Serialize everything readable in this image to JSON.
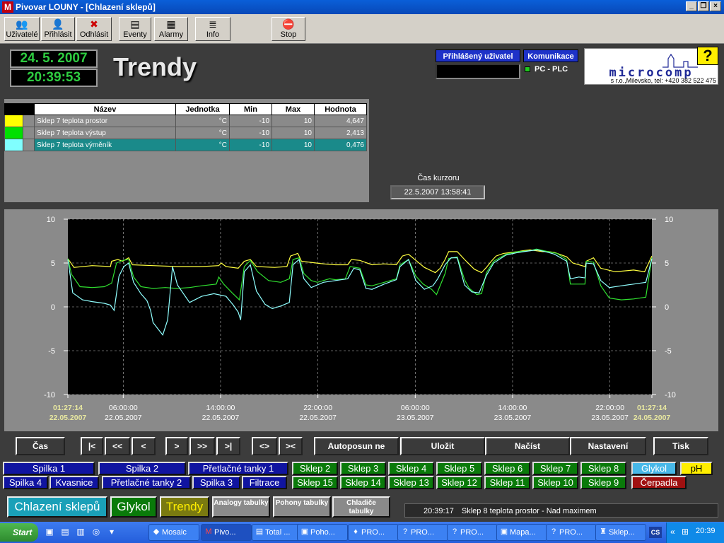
{
  "window": {
    "title": "Pivovar LOUNY - [Chlazení sklepů]"
  },
  "toolbar": [
    {
      "label": "Uživatelé",
      "icon": "users-icon",
      "glyph": "👥"
    },
    {
      "label": "Přihlásit",
      "icon": "login-icon",
      "glyph": "👤"
    },
    {
      "label": "Odhlásit",
      "icon": "logout-icon",
      "glyph": "✖"
    },
    {
      "label": "Eventy",
      "icon": "events-icon",
      "glyph": "▤"
    },
    {
      "label": "Alarmy",
      "icon": "alarms-icon",
      "glyph": "▦"
    },
    {
      "label": "Info",
      "icon": "info-icon",
      "glyph": "≣"
    },
    {
      "label": "Stop",
      "icon": "stop-icon",
      "glyph": "⛔"
    }
  ],
  "header": {
    "date": "24. 5. 2007",
    "time": "20:39:53",
    "title": "Trendy",
    "logged_user_label": "Přihlášený uživatel",
    "comm_label": "Komunikace",
    "comm_status": "PC - PLC",
    "logo_text": "microcomp",
    "logo_sub": "s r.o.,Milevsko, tel: +420 382 522 475",
    "help": "?"
  },
  "legend": {
    "headers": [
      "Název",
      "Jednotka",
      "Min",
      "Max",
      "Hodnota"
    ],
    "rows": [
      {
        "color": "#ffff00",
        "name": "Sklep 7 teplota prostor",
        "unit": "°C",
        "min": "-10",
        "max": "10",
        "value": "4,647"
      },
      {
        "color": "#00e000",
        "name": "Sklep 7 teplota výstup",
        "unit": "°C",
        "min": "-10",
        "max": "10",
        "value": "2,413"
      },
      {
        "color": "#80ffff",
        "name": "Sklep 7 teplota výměník",
        "unit": "°C",
        "min": "-10",
        "max": "10",
        "value": "0,476"
      }
    ]
  },
  "cursor": {
    "label": "Čas kurzoru",
    "value": "22.5.2007 13:58:41"
  },
  "chart_data": {
    "type": "line",
    "ylim": [
      -10,
      10
    ],
    "y_ticks": [
      "10",
      "5",
      "0",
      "-5",
      "-10"
    ],
    "x_ticks": [
      {
        "time": "01:27:14",
        "date": "22.05.2007"
      },
      {
        "time": "06:00:00",
        "date": "22.05.2007"
      },
      {
        "time": "14:00:00",
        "date": "22.05.2007"
      },
      {
        "time": "22:00:00",
        "date": "22.05.2007"
      },
      {
        "time": "06:00:00",
        "date": "23.05.2007"
      },
      {
        "time": "14:00:00",
        "date": "23.05.2007"
      },
      {
        "time": "22:00:00",
        "date": "23.05.2007"
      },
      {
        "time": "01:27:14",
        "date": "24.05.2007"
      }
    ],
    "x_hours": [
      0,
      4.55,
      12.55,
      20.55,
      28.55,
      36.55,
      44.55,
      48
    ],
    "series": [
      {
        "name": "Sklep 7 teplota prostor",
        "color": "#ffff40",
        "points": [
          [
            0,
            5.5
          ],
          [
            0.5,
            4.5
          ],
          [
            2,
            4.7
          ],
          [
            3.5,
            4.6
          ],
          [
            3.6,
            5.2
          ],
          [
            4.1,
            5.4
          ],
          [
            4.5,
            5.2
          ],
          [
            5,
            5.6
          ],
          [
            5.3,
            4.8
          ],
          [
            7,
            4.7
          ],
          [
            9,
            4.6
          ],
          [
            11,
            4.6
          ],
          [
            12.4,
            4.7
          ],
          [
            12.6,
            5
          ],
          [
            13,
            4.6
          ],
          [
            14,
            4.4
          ],
          [
            14.5,
            5.2
          ],
          [
            15,
            5.4
          ],
          [
            15.5,
            4.6
          ],
          [
            17,
            4.5
          ],
          [
            18,
            4.6
          ],
          [
            18.3,
            5.8
          ],
          [
            18.9,
            6.1
          ],
          [
            19.2,
            5.2
          ],
          [
            20.4,
            5
          ],
          [
            21,
            4.9
          ],
          [
            22,
            4.8
          ],
          [
            23,
            4.8
          ],
          [
            23.3,
            5.4
          ],
          [
            24,
            5.3
          ],
          [
            25,
            4.8
          ],
          [
            26,
            4.9
          ],
          [
            27,
            4.8
          ],
          [
            27.5,
            5.8
          ],
          [
            28,
            6
          ],
          [
            28.6,
            5.3
          ],
          [
            29.3,
            4.5
          ],
          [
            30.2,
            3.9
          ],
          [
            30.6,
            4.4
          ],
          [
            31,
            5.4
          ],
          [
            31.3,
            6.3
          ],
          [
            32,
            6.3
          ],
          [
            32.6,
            5.4
          ],
          [
            33.4,
            4.3
          ],
          [
            34,
            3.9
          ],
          [
            34.4,
            4.5
          ],
          [
            34.8,
            5.2
          ],
          [
            35.2,
            5.8
          ],
          [
            35.8,
            6.1
          ],
          [
            36.4,
            6.2
          ],
          [
            37,
            6.3
          ],
          [
            37.4,
            6.4
          ],
          [
            38,
            6.5
          ],
          [
            38.5,
            6.4
          ],
          [
            39,
            6.3
          ],
          [
            39.5,
            6.3
          ],
          [
            40,
            6.2
          ],
          [
            41,
            5.7
          ],
          [
            41.5,
            5
          ],
          [
            42.5,
            4.6
          ],
          [
            42.6,
            5.2
          ],
          [
            43.2,
            5.6
          ],
          [
            43.8,
            4.4
          ],
          [
            45,
            4
          ],
          [
            46.5,
            4.2
          ],
          [
            47.4,
            4
          ],
          [
            48,
            5.8
          ]
        ]
      },
      {
        "name": "Sklep 7 teplota výstup",
        "color": "#30e030",
        "points": [
          [
            0,
            5.5
          ],
          [
            0.3,
            3.7
          ],
          [
            1,
            2.3
          ],
          [
            2,
            2.2
          ],
          [
            3,
            2.3
          ],
          [
            3.6,
            2.7
          ],
          [
            4,
            5
          ],
          [
            4.5,
            5.3
          ],
          [
            5,
            5.4
          ],
          [
            5.4,
            3.4
          ],
          [
            6,
            2.3
          ],
          [
            7,
            2.1
          ],
          [
            8,
            2.2
          ],
          [
            9,
            2.1
          ],
          [
            10,
            2.2
          ],
          [
            11,
            2.4
          ],
          [
            12.2,
            2.6
          ],
          [
            12.4,
            3.4
          ],
          [
            12.8,
            2.6
          ],
          [
            13.5,
            1.6
          ],
          [
            14.1,
            0.8
          ],
          [
            14.5,
            4.6
          ],
          [
            15,
            5.3
          ],
          [
            15.6,
            4
          ],
          [
            16.5,
            3
          ],
          [
            17.5,
            2.8
          ],
          [
            18.2,
            3.2
          ],
          [
            18.5,
            5.4
          ],
          [
            19,
            5.6
          ],
          [
            19.4,
            3.8
          ],
          [
            20,
            3
          ],
          [
            20.5,
            2.8
          ],
          [
            21,
            3
          ],
          [
            21.5,
            3.2
          ],
          [
            22,
            3.1
          ],
          [
            22.8,
            3.2
          ],
          [
            23.2,
            4.6
          ],
          [
            24,
            4.4
          ],
          [
            24.5,
            2.5
          ],
          [
            25,
            2.4
          ],
          [
            26,
            2.8
          ],
          [
            27,
            3.2
          ],
          [
            27.3,
            4.8
          ],
          [
            28,
            5.4
          ],
          [
            28.6,
            3.5
          ],
          [
            29.2,
            2.6
          ],
          [
            29.9,
            2
          ],
          [
            30.3,
            1.4
          ],
          [
            31,
            3.8
          ],
          [
            31.3,
            5.5
          ],
          [
            32,
            5.7
          ],
          [
            32.6,
            3.1
          ],
          [
            33,
            2.1
          ],
          [
            33.6,
            1.4
          ],
          [
            34,
            1.5
          ],
          [
            34.4,
            3.9
          ],
          [
            35,
            5.2
          ],
          [
            36,
            6
          ],
          [
            37,
            6.3
          ],
          [
            38,
            6.4
          ],
          [
            38.5,
            6.6
          ],
          [
            39.5,
            6.3
          ],
          [
            40.2,
            6.1
          ],
          [
            41,
            5.4
          ],
          [
            41.3,
            2.6
          ],
          [
            42,
            2.6
          ],
          [
            42.5,
            2.6
          ],
          [
            42.6,
            5.2
          ],
          [
            43.2,
            5.1
          ],
          [
            43.8,
            2.4
          ],
          [
            44.5,
            1
          ],
          [
            45.5,
            0.8
          ],
          [
            46.5,
            0.9
          ],
          [
            47.5,
            1.1
          ],
          [
            48,
            5.6
          ]
        ]
      },
      {
        "name": "Sklep 7 teplota výměník",
        "color": "#90ffff",
        "points": [
          [
            0,
            5.4
          ],
          [
            0.4,
            1.6
          ],
          [
            1.2,
            0.8
          ],
          [
            2,
            0.6
          ],
          [
            3,
            0.4
          ],
          [
            3.5,
            0.2
          ],
          [
            3.8,
            -0.4
          ],
          [
            4.2,
            3.5
          ],
          [
            4.6,
            4.6
          ],
          [
            5,
            5
          ],
          [
            5.4,
            2.8
          ],
          [
            6,
            1.5
          ],
          [
            6.5,
            0.7
          ],
          [
            6.8,
            -0.4
          ],
          [
            7,
            -1.8
          ],
          [
            7.4,
            -2.5
          ],
          [
            7.8,
            -3.2
          ],
          [
            8.2,
            -1.5
          ],
          [
            8.6,
            4.6
          ],
          [
            9,
            2.5
          ],
          [
            10,
            0.5
          ],
          [
            11,
            1.2
          ],
          [
            12,
            1.5
          ],
          [
            13,
            1.2
          ],
          [
            13.6,
            0.2
          ],
          [
            14,
            -0.6
          ],
          [
            14.2,
            -1.5
          ],
          [
            14.5,
            4
          ],
          [
            15,
            4.8
          ],
          [
            15.5,
            1.8
          ],
          [
            16.2,
            0.3
          ],
          [
            16.8,
            -0.2
          ],
          [
            17.5,
            0.1
          ],
          [
            18.2,
            0.5
          ],
          [
            18.5,
            4.8
          ],
          [
            19,
            5.4
          ],
          [
            19.4,
            3.2
          ],
          [
            20,
            2.2
          ],
          [
            21,
            2.8
          ],
          [
            22,
            3
          ],
          [
            23,
            3.2
          ],
          [
            23.5,
            4.4
          ],
          [
            24,
            4.2
          ],
          [
            24.5,
            2.1
          ],
          [
            25,
            2
          ],
          [
            26,
            2.6
          ],
          [
            27,
            3.1
          ],
          [
            27.3,
            4.6
          ],
          [
            28,
            5.4
          ],
          [
            28.6,
            3
          ],
          [
            29.3,
            2
          ],
          [
            30,
            2.4
          ],
          [
            30.4,
            3.2
          ],
          [
            31,
            4.8
          ],
          [
            31.5,
            5.6
          ],
          [
            32,
            5.6
          ],
          [
            32.6,
            2.5
          ],
          [
            33.2,
            1.7
          ],
          [
            33.8,
            1.6
          ],
          [
            34.4,
            3.6
          ],
          [
            35,
            5
          ],
          [
            36,
            5.9
          ],
          [
            37,
            6.2
          ],
          [
            38,
            6.4
          ],
          [
            38.6,
            6.5
          ],
          [
            39.5,
            6.2
          ],
          [
            40,
            6
          ],
          [
            41,
            5.2
          ],
          [
            41.3,
            3.2
          ],
          [
            42,
            3.4
          ],
          [
            42.5,
            3.3
          ],
          [
            42.6,
            5
          ],
          [
            43.2,
            4.9
          ],
          [
            43.8,
            3
          ],
          [
            44.5,
            2.2
          ],
          [
            45.5,
            2.4
          ],
          [
            46.5,
            2.6
          ],
          [
            47.5,
            2.8
          ],
          [
            48,
            5.5
          ]
        ]
      }
    ]
  },
  "nav": {
    "cas": "Čas",
    "first": "|<",
    "prev2": "<<",
    "prev": "<",
    "next": ">",
    "next2": ">>",
    "last": ">|",
    "zoom_out": "<>",
    "zoom_in": "><",
    "autoposun": "Autoposun ne",
    "save": "Uložit",
    "load": "Načíst",
    "settings": "Nastavení",
    "print": "Tisk"
  },
  "tabs_row1": [
    "Spilka 1",
    "Spilka 2",
    "Přetlačné tanky 1",
    "Sklep 2",
    "Sklep 3",
    "Sklep 4",
    "Sklep 5",
    "Sklep 6",
    "Sklep 7",
    "Sklep 8",
    "Glykol",
    "pH"
  ],
  "tabs_row2": [
    "Spilka 4",
    "Kvasnice",
    "Přetlačné tanky 2",
    "Spilka 3",
    "Filtrace",
    "Sklep 15",
    "Sklep 14",
    "Sklep 13",
    "Sklep 12",
    "Sklep 11",
    "Sklep 10",
    "Sklep 9",
    "Čerpadla"
  ],
  "bottom": {
    "chlazeni": "Chlazení sklepů",
    "glykol": "Glykol",
    "trendy": "Trendy",
    "analogy": "Analogy tabulky",
    "pohony": "Pohony tabulky",
    "chladice": "Chladiče tabulky",
    "alarm_time": "20:39:17",
    "alarm_text": "Sklep 8 teplota prostor - Nad maximem"
  },
  "taskbar": {
    "start": "Start",
    "tasks": [
      "Mosaic",
      "Pivo...",
      "Total ...",
      "Poho...",
      "PRO...",
      "PRO...",
      "PRO...",
      "Mapa...",
      "PRO...",
      "Sklep..."
    ],
    "lang": "CS",
    "clock": "20:39"
  }
}
